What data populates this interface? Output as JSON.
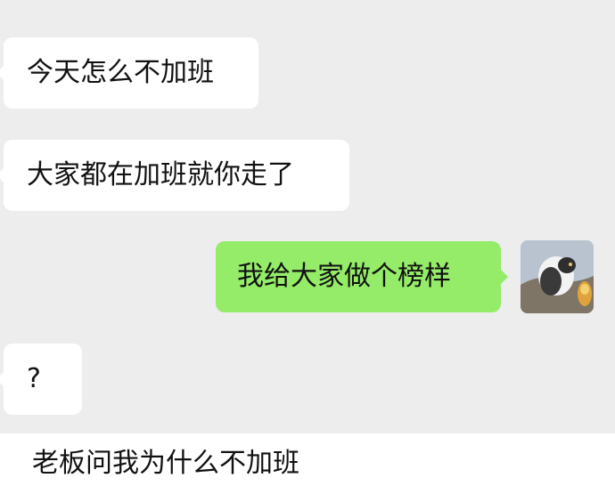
{
  "messages": [
    {
      "side": "left",
      "text": "今天怎么不加班"
    },
    {
      "side": "left",
      "text": "大家都在加班就你走了"
    },
    {
      "side": "right",
      "text": "我给大家做个榜样"
    },
    {
      "side": "left",
      "text": "?"
    }
  ],
  "caption": "老板问我为什么不加班",
  "colors": {
    "chat_background": "#ededed",
    "incoming_bubble": "#ffffff",
    "outgoing_bubble": "#95ec69"
  },
  "icons": {
    "avatar": "cat-photo-avatar"
  }
}
